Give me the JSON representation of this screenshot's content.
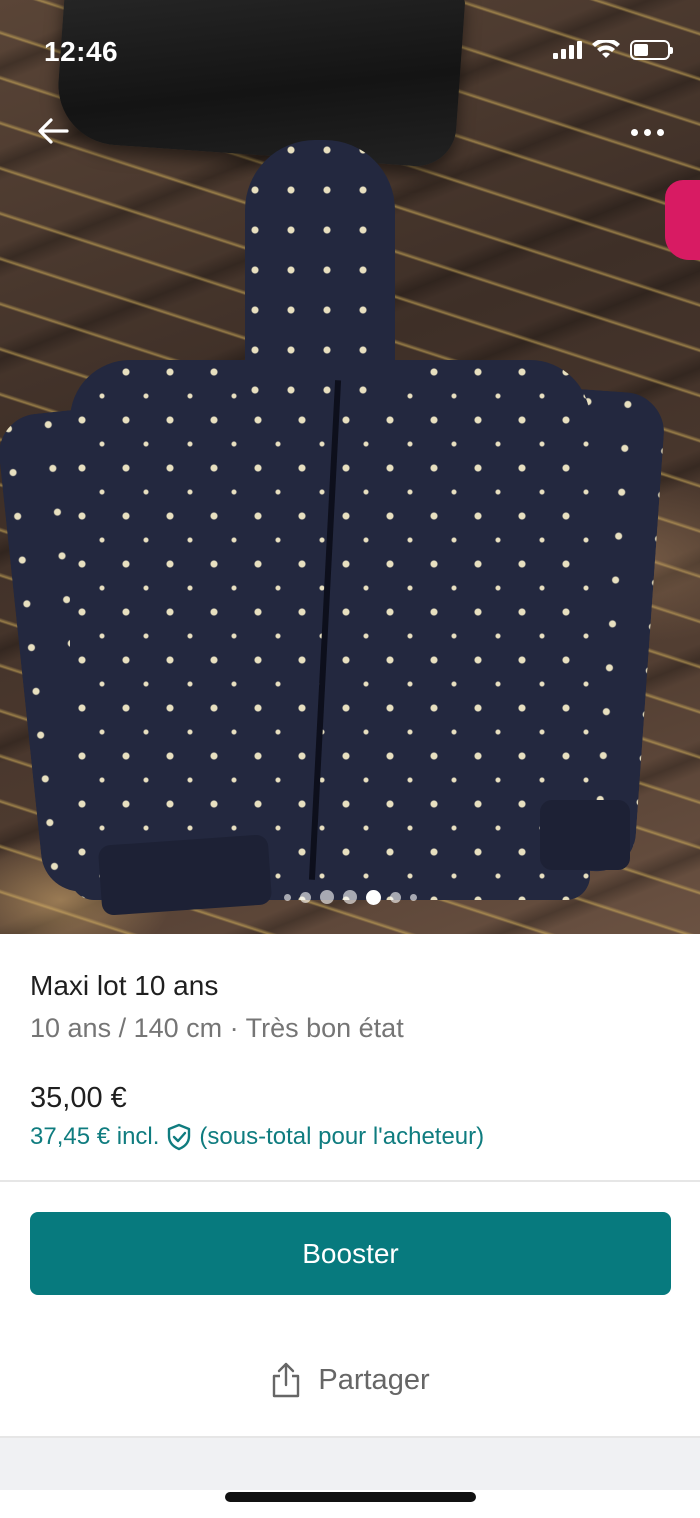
{
  "status_bar": {
    "time": "12:46"
  },
  "photo": {
    "icon_back": "arrow-left-icon",
    "icon_more": "more-horizontal-icon",
    "pager_total": 7,
    "pager_active_index": 4
  },
  "item": {
    "title": "Maxi lot 10 ans",
    "subtitle": "10 ans / 140 cm · Très bon état",
    "price": "35,00 €",
    "price_incl": "37,45 € incl.",
    "price_incl_note": "(sous-total pour l'acheteur)"
  },
  "actions": {
    "booster_label": "Booster",
    "share_label": "Partager"
  },
  "colors": {
    "accent": "#077a7e",
    "price_incl_text": "#0f7c7f"
  }
}
